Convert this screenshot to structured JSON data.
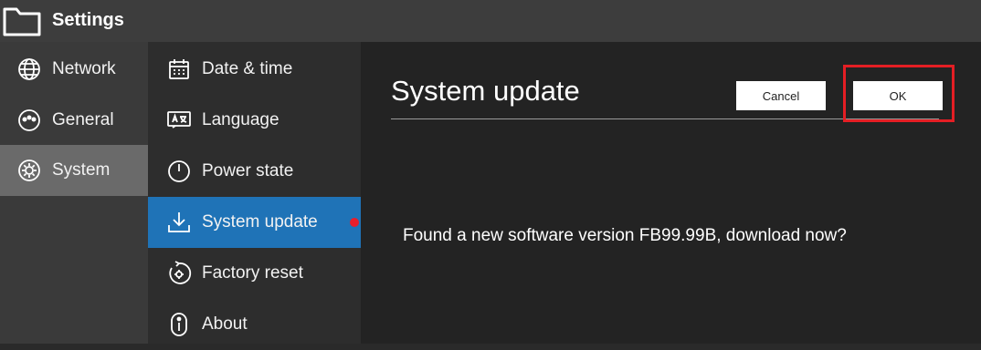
{
  "window": {
    "title": "Settings"
  },
  "categories": [
    {
      "label": "Network",
      "icon": "globe-icon"
    },
    {
      "label": "General",
      "icon": "general-icon"
    },
    {
      "label": "System",
      "icon": "gear-icon",
      "selected": true
    }
  ],
  "system_menu": [
    {
      "label": "Date & time",
      "icon": "calendar-icon"
    },
    {
      "label": "Language",
      "icon": "language-icon"
    },
    {
      "label": "Power state",
      "icon": "power-icon"
    },
    {
      "label": "System update",
      "icon": "download-icon",
      "selected": true,
      "notification": true
    },
    {
      "label": "Factory reset",
      "icon": "factory-reset-icon"
    },
    {
      "label": "About",
      "icon": "info-icon"
    }
  ],
  "main": {
    "title": "System update",
    "cancel_label": "Cancel",
    "ok_label": "OK",
    "message": "Found a new software version FB99.99B, download now?"
  },
  "colors": {
    "titlebar_bg": "#3d3d3d",
    "selected_category_bg": "#6a6a6a",
    "selected_item_bg": "#1f73b7",
    "notification_dot": "#e81e2a",
    "highlight_border": "#e41e24"
  }
}
